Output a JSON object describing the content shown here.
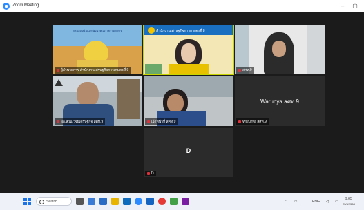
{
  "window": {
    "title": "Zoom Meeting"
  },
  "tiles": [
    {
      "name": "ผู้อำนวยการ สำนักงานเศรษฐกิจการเกษตรที่ 9",
      "banner": "กลุ่มส่งเสริมและพัฒนาคุณภาพการเกษตร"
    },
    {
      "name": "",
      "header": "สำนักงานเศรษฐกิจการเกษตรที่ 8"
    },
    {
      "name": "สศท.9"
    },
    {
      "name": "ผอ.ส่วน วิจัยเศรษฐกิจ สศท.9"
    },
    {
      "name": "เจ้าหน้าที่ สศท.9"
    },
    {
      "name": "Warunya สศท.9",
      "display": "Warunya สศท.9"
    },
    {
      "name": "D",
      "display": "D"
    }
  ],
  "taskbar": {
    "search_label": "Search",
    "clock": "9:05",
    "date": "25/3/2568",
    "lang": "ENG"
  },
  "colors": {
    "active_border": "#c8d400",
    "muted": "#e0303a"
  }
}
